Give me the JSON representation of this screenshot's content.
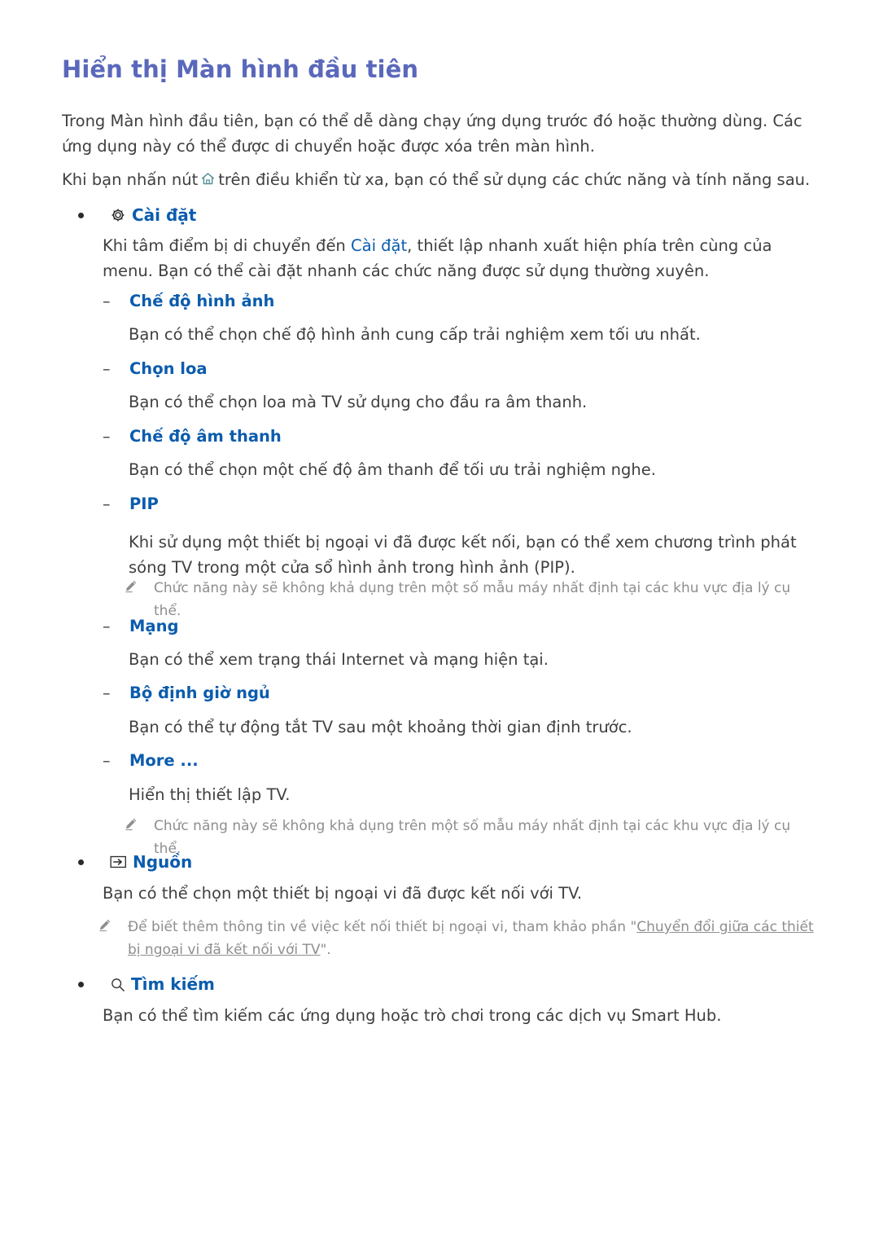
{
  "document": {
    "title": "Hiển thị Màn hình đầu tiên",
    "intro": {
      "paragraph_1": "Trong Màn hình đầu tiên, bạn có thể dễ dàng chạy ứng dụng trước đó hoặc thường dùng. Các ứng dụng này có thể được di chuyển hoặc được xóa trên màn hình.",
      "paragraph_2_before_icon": "Khi bạn nhấn nút",
      "paragraph_2_icon": "home-icon",
      "paragraph_2_after_icon": "trên điều khiển từ xa, bạn có thể sử dụng các chức năng và tính năng sau."
    },
    "sections": [
      {
        "icon": "gear-icon",
        "label": "Cài đặt",
        "body_before_link": "Khi tâm điểm bị di chuyển đến ",
        "body_link": "Cài đặt",
        "body_after_link": ", thiết lập nhanh xuất hiện phía trên cùng của menu. Bạn có thể cài đặt nhanh các chức năng được sử dụng thường xuyên.",
        "subitems": [
          {
            "label": "Chế độ hình ảnh",
            "body": "Bạn có thể chọn chế độ hình ảnh cung cấp trải nghiệm xem tối ưu nhất."
          },
          {
            "label": "Chọn loa",
            "body": "Bạn có thể chọn loa mà TV sử dụng cho đầu ra âm thanh."
          },
          {
            "label": "Chế độ âm thanh",
            "body": "Bạn có thể chọn một chế độ âm thanh để tối ưu trải nghiệm nghe."
          },
          {
            "label": "PIP",
            "body": "Khi sử dụng một thiết bị ngoại vi đã được kết nối, bạn có thể xem chương trình phát sóng TV trong một cửa sổ hình ảnh trong hình ảnh (PIP).",
            "note": "Chức năng này sẽ không khả dụng trên một số mẫu máy nhất định tại các khu vực địa lý cụ thể."
          },
          {
            "label": "Mạng",
            "body": "Bạn có thể xem trạng thái Internet và mạng hiện tại."
          },
          {
            "label": "Bộ định giờ ngủ",
            "body": "Bạn có thể tự động tắt TV sau một khoảng thời gian định trước."
          },
          {
            "label": "More ...",
            "body": "Hiển thị thiết lập TV.",
            "note": "Chức năng này sẽ không khả dụng trên một số mẫu máy nhất định tại các khu vực địa lý cụ thể."
          }
        ]
      },
      {
        "icon": "source-icon",
        "label": "Nguồn",
        "body": "Bạn có thể chọn một thiết bị ngoại vi đã được kết nối với TV.",
        "note_before_link": "Để biết thêm thông tin về việc kết nối thiết bị ngoại vi, tham khảo phần \"",
        "note_link": "Chuyển đổi giữa các thiết bị ngoại vi đã kết nối với TV",
        "note_after_link": "\"."
      },
      {
        "icon": "search-icon",
        "label": "Tìm kiếm",
        "body": "Bạn có thể tìm kiếm các ứng dụng hoặc trò chơi trong các dịch vụ Smart Hub."
      }
    ],
    "colors": {
      "title": "#5a68bb",
      "link_blue": "#0b5cad",
      "body_text": "#3f3f3f",
      "note_gray": "#8e8e8e",
      "home_icon": "#4f8f95"
    }
  }
}
